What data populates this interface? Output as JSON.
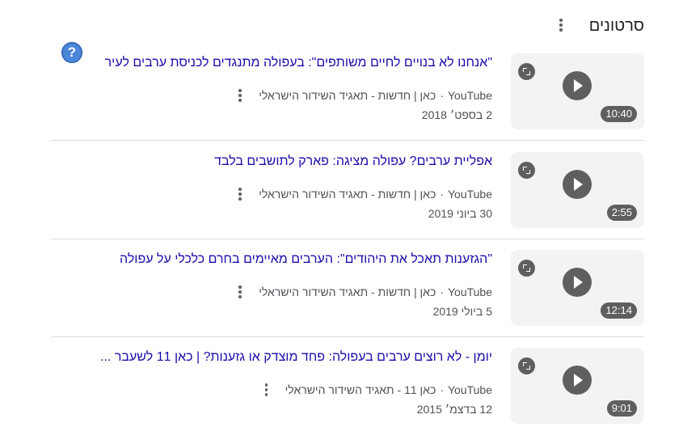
{
  "header": {
    "title": "סרטונים",
    "more_icon": "more-vert-icon"
  },
  "help": {
    "label": "?"
  },
  "videos": [
    {
      "title": "\"אנחנו לא בנויים לחיים משותפים\": בעפולה מתנגדים לכניסת ערבים לעיר",
      "source": "YouTube",
      "channel": "כאן | חדשות - תאגיד השידור הישראלי",
      "date": "2 בספט׳ 2018",
      "duration": "10:40"
    },
    {
      "title": "אפליית ערבים? עפולה מציגה: פארק לתושבים בלבד",
      "source": "YouTube",
      "channel": "כאן | חדשות - תאגיד השידור הישראלי",
      "date": "30 ביוני 2019",
      "duration": "2:55"
    },
    {
      "title": "\"הגזענות תאכל את היהודים\": הערבים מאיימים בחרם כלכלי על עפולה",
      "source": "YouTube",
      "channel": "כאן | חדשות - תאגיד השידור הישראלי",
      "date": "5 ביולי 2019",
      "duration": "12:14"
    },
    {
      "title": "יומן - לא רוצים ערבים בעפולה: פחד מוצדק או גזענות? | כאן 11 לשעבר ...",
      "source": "YouTube",
      "channel": "כאן 11 - תאגיד השידור הישראלי",
      "date": "12 בדצמ׳ 2015",
      "duration": "9:01"
    }
  ],
  "separator": "·",
  "colors": {
    "title_link": "#1a0dab",
    "meta": "#4d5156",
    "divider": "#dadce0",
    "thumb_bg": "#f1f3f4",
    "help_icon": "#4b87d8"
  }
}
